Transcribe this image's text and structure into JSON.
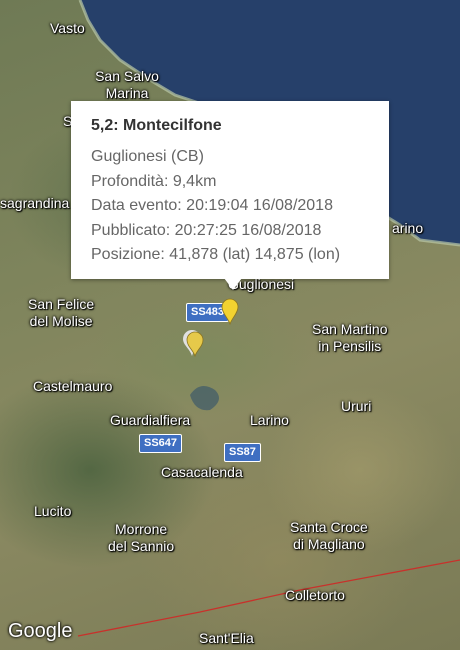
{
  "map": {
    "places": [
      {
        "id": "vasto",
        "label": "Vasto"
      },
      {
        "id": "san-salvo",
        "label": "San Salvo\nMarina"
      },
      {
        "id": "sagrandina",
        "label": "sagrandina"
      },
      {
        "id": "marino",
        "label": "arino"
      },
      {
        "id": "guglionesi",
        "label": "Guglionesi"
      },
      {
        "id": "san-felice",
        "label": "San Felice\ndel Molise"
      },
      {
        "id": "san-martino",
        "label": "San Martino\nin Pensilis"
      },
      {
        "id": "castelmauro",
        "label": "Castelmauro"
      },
      {
        "id": "ururi",
        "label": "Ururi"
      },
      {
        "id": "guardialfiera",
        "label": "Guardialfiera"
      },
      {
        "id": "larino",
        "label": "Larino"
      },
      {
        "id": "casacalenda",
        "label": "Casacalenda"
      },
      {
        "id": "lucito",
        "label": "Lucito"
      },
      {
        "id": "morrone",
        "label": "Morrone\ndel Sannio"
      },
      {
        "id": "santa-croce",
        "label": "Santa Croce\ndi Magliano"
      },
      {
        "id": "colletorto",
        "label": "Colletorto"
      },
      {
        "id": "sant-elia",
        "label": "Sant'Elia"
      }
    ],
    "roads": [
      {
        "id": "ss483",
        "label": "SS483"
      },
      {
        "id": "ss647",
        "label": "SS647"
      },
      {
        "id": "ss87",
        "label": "SS87"
      }
    ],
    "fragment_s": "S"
  },
  "popup": {
    "title": "5,2: Montecilfone",
    "lines": [
      "Guglionesi (CB)",
      "Profondità: 9,4km",
      "Data evento: 20:19:04 16/08/2018",
      "Pubblicato: 20:27:25 16/08/2018",
      "Posizione: 41,878 (lat) 14,875 (lon)"
    ]
  },
  "logo": "Google",
  "colors": {
    "sea": "#26406a",
    "marker_selected": "#f2d230",
    "marker_other": "#e6c94a",
    "road_shield": "#3f6fc2",
    "fault_line": "#c8312b"
  },
  "icons": {
    "marker": "map-marker-icon"
  }
}
